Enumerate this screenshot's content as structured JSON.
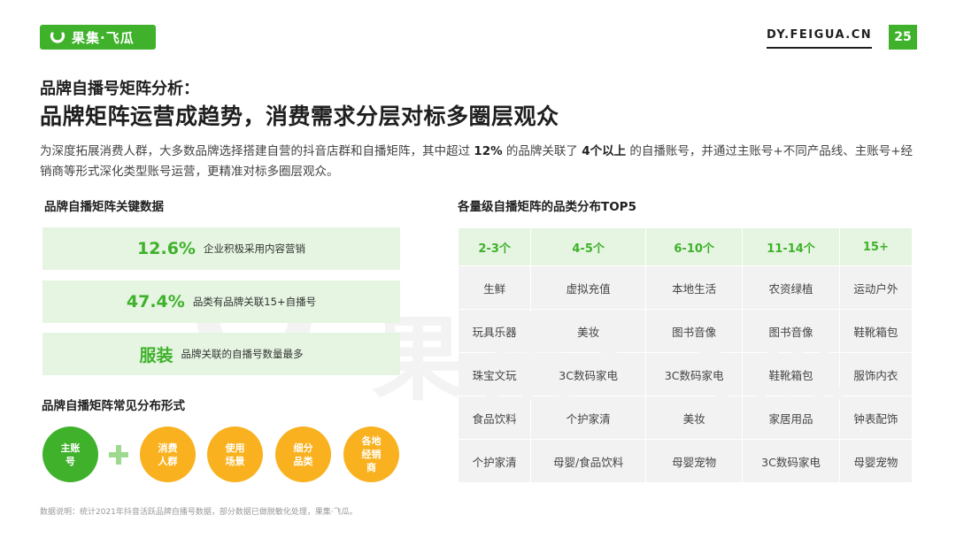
{
  "header": {
    "logo_text": "果集·飞瓜",
    "site": "DY.FEIGUA.CN",
    "page_number": "25"
  },
  "subtitle": "品牌自播号矩阵分析：",
  "title": "品牌矩阵运营成趋势，消费需求分层对标多圈层观众",
  "description": {
    "part1": "为深度拓展消费人群，大多数品牌选择搭建自营的抖音店群和自播矩阵，其中超过 ",
    "bold1": "12%",
    "part2": " 的品牌关联了 ",
    "bold2": "4个以上",
    "part3": " 的自播账号，并通过主账号+不同产品线、主账号+经销商等形式深化类型账号运营，更精准对标多圈层观众。"
  },
  "key_data": {
    "label": "品牌自播矩阵关键数据",
    "stats": [
      {
        "value": "12.6%",
        "text": "企业积极采用内容营销"
      },
      {
        "value": "47.4%",
        "text": "品类有品牌关联15+自播号"
      },
      {
        "value": "服装",
        "text": "品牌关联的自播号数量最多"
      }
    ]
  },
  "distribution": {
    "label": "品牌自播矩阵常见分布形式",
    "main": "主账号",
    "items": [
      "消费人群",
      "使用场景",
      "细分品类",
      "各地经销商"
    ],
    "colors": {
      "main": "#3fb12b",
      "items": "#f9b11f"
    }
  },
  "category_table": {
    "label": "各量级自播矩阵的品类分布TOP5",
    "headers": [
      "2-3个",
      "4-5个",
      "6-10个",
      "11-14个",
      "15+"
    ],
    "rows": [
      [
        "生鲜",
        "虚拟充值",
        "本地生活",
        "农资绿植",
        "运动户外"
      ],
      [
        "玩具乐器",
        "美妆",
        "图书音像",
        "图书音像",
        "鞋靴箱包"
      ],
      [
        "珠宝文玩",
        "3C数码家电",
        "3C数码家电",
        "鞋靴箱包",
        "服饰内衣"
      ],
      [
        "食品饮料",
        "个护家清",
        "美妆",
        "家居用品",
        "钟表配饰"
      ],
      [
        "个护家清",
        "母婴/食品饮料",
        "母婴宠物",
        "3C数码家电",
        "母婴宠物"
      ]
    ]
  },
  "note": "数据说明：统计2021年抖音活跃品牌自播号数据，部分数据已做脱敏化处理，果集·飞瓜。",
  "watermark_text": "果集·飞瓜",
  "colors": {
    "brand_green": "#3fb12b",
    "light_green": "#e5f5e1",
    "orange": "#f9b11f",
    "cell_gray": "#f2f2f2"
  }
}
